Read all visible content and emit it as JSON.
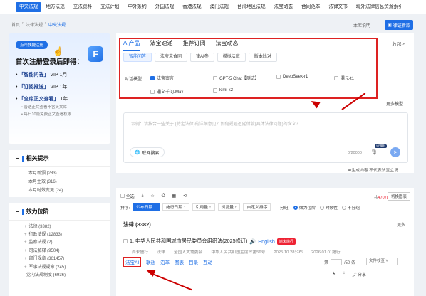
{
  "topnav": {
    "items": [
      "中央法规",
      "地方法规",
      "立法资料",
      "立法计划",
      "中外条约",
      "外国法规",
      "香港法规",
      "澳门法规",
      "台湾地区法规",
      "法宝动态",
      "合同范本",
      "法律文书",
      "境外法律信息资源索引"
    ]
  },
  "breadcrumb": {
    "items": [
      "首页",
      "法律法规",
      "中央法规"
    ]
  },
  "header": {
    "help": "本库说明",
    "pay": "律证新款"
  },
  "promo": {
    "tag": "点击快捷注册",
    "logo": "F",
    "headline": "首次注册登录后即得：",
    "benefits": [
      {
        "name": "「智能问答」",
        "val": "VIP 1月"
      },
      {
        "name": "「订阅推送」",
        "val": "VIP 1年"
      },
      {
        "name": "「全库正文查看」",
        "val": "1年"
      }
    ],
    "subs": [
      "• 普送正文查看不含英文库",
      "• 每日10篇免费正文查看权限"
    ]
  },
  "related": {
    "title": "相关提示",
    "items": [
      "本月新颁 (283)",
      "本月生效 (316)",
      "本月时效变更 (24)"
    ]
  },
  "levels": {
    "title": "效力位阶",
    "items": [
      "法律 (3382)",
      "行政法规 (12833)",
      "监察法规 (2)",
      "司法解释 (9504)",
      "部门规章 (361457)",
      "军事法规规章 (245)",
      "党内法规制度 (6936)"
    ]
  },
  "ai": {
    "tabs": [
      "AI产品",
      "法宝速递",
      "推荐订阅",
      "法宝动态"
    ],
    "collapse": "收起 ˄",
    "sub_tabs": [
      "智能问答",
      "法宝来合同",
      "律AI参",
      "模拟法庭",
      "版本比对"
    ],
    "models_label": "对话模型",
    "models": [
      "法宝审言",
      "GPT-5 Chat【测试】",
      "DeepSeek-r1",
      "混元-t1",
      "通义千问-Max",
      "kimi-k2"
    ],
    "more_models": "更多模型",
    "placeholder": "示例：请按合一些关于 (特定法律)的详细意见？如何规避迟延付款(具体法律问题)的含义？",
    "web_search": "联网搜索",
    "counter": "0/20000",
    "mic_badge": "VIP福利",
    "disclaimer": "AI生成内容 不代表法宝立场"
  },
  "results": {
    "select_all": "全选",
    "total_prefix": "共",
    "total": "470787",
    "total_suffix": "篇",
    "switch": "切换图表",
    "sort_label": "排序:",
    "sort": [
      "公布日期 ↓",
      "施行日期 ↕",
      "引用量 ↕",
      "浏览量 ↕",
      "自定义排序"
    ],
    "group_label": "分组:",
    "groups": [
      "效力位阶",
      "时效性",
      "不分组"
    ],
    "section": "法律 (3382)",
    "section_more": "更多",
    "item": {
      "title": "1. 中华人民共和国城市居民委员会组织法(2025修订)",
      "en": "English",
      "badge": "尚未施行",
      "meta": [
        "尚未施行",
        "法律",
        "全国人大常委会",
        "中华人民共和国主席令第56号",
        "2025.10.28公布",
        "2026.01.01施行"
      ],
      "actions": [
        "法宝AI",
        "联想",
        "沿革",
        "图表",
        "目录",
        "互动"
      ],
      "page_label": "第",
      "page_total": "/50 条",
      "compare": "文件校查",
      "icons": [
        "★",
        "↓",
        "⤴ 分享"
      ]
    }
  }
}
